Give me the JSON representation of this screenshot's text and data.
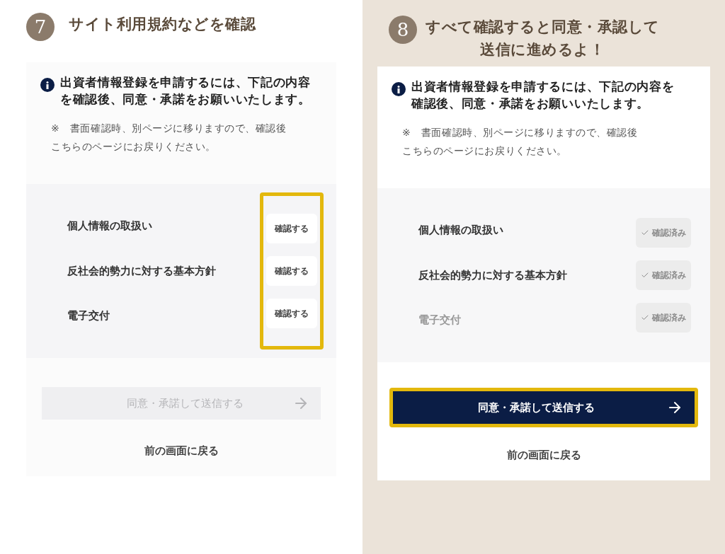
{
  "panels": [
    {
      "shaded": false,
      "step": "7",
      "caption_lines": [
        "サイト利用規約などを確認"
      ],
      "notice": "出資者情報登録を申請するには、下記の内容を確認後、同意・承諾をお願いいたします。",
      "note": "※　書面確認時、別ページに移りますので、確認後こちらのページにお戻りください。",
      "buttons_highlighted": true,
      "submit_highlighted": false,
      "documents": [
        {
          "title": "個人情報の取扱い",
          "button": "確認する",
          "confirmed": false,
          "muted": false
        },
        {
          "title": "反社会的勢力に対する基本方針",
          "button": "確認する",
          "confirmed": false,
          "muted": false
        },
        {
          "title": "電子交付",
          "button": "確認する",
          "confirmed": false,
          "muted": false
        }
      ],
      "submit": {
        "label": "同意・承諾して送信する",
        "enabled": false
      },
      "back": "前の画面に戻る"
    },
    {
      "shaded": true,
      "step": "8",
      "caption_lines": [
        "すべて確認すると同意・承認して",
        "送信に進めるよ！"
      ],
      "notice": "出資者情報登録を申請するには、下記の内容を確認後、同意・承諾をお願いいたします。",
      "note": "※　書面確認時、別ページに移りますので、確認後こちらのページにお戻りください。",
      "buttons_highlighted": false,
      "submit_highlighted": true,
      "documents": [
        {
          "title": "個人情報の取扱い",
          "button": "確認済み",
          "confirmed": true,
          "muted": false
        },
        {
          "title": "反社会的勢力に対する基本方針",
          "button": "確認済み",
          "confirmed": true,
          "muted": false
        },
        {
          "title": "電子交付",
          "button": "確認済み",
          "confirmed": true,
          "muted": true
        }
      ],
      "submit": {
        "label": "同意・承諾して送信する",
        "enabled": true
      },
      "back": "前の画面に戻る"
    }
  ]
}
